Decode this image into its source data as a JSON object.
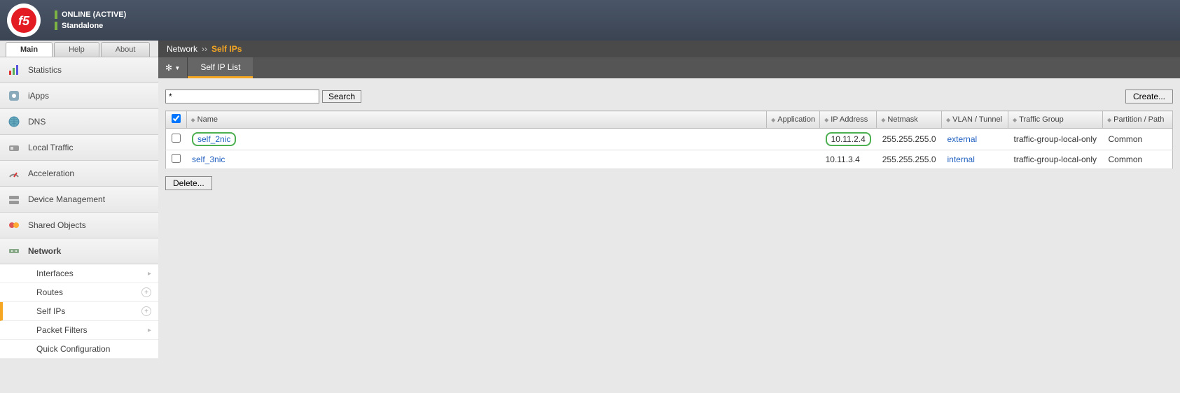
{
  "header": {
    "status_main": "ONLINE (ACTIVE)",
    "status_sub": "Standalone"
  },
  "top_tabs": [
    {
      "label": "Main",
      "active": true
    },
    {
      "label": "Help",
      "active": false
    },
    {
      "label": "About",
      "active": false
    }
  ],
  "sidebar": {
    "items": [
      {
        "label": "Statistics",
        "icon": "stats"
      },
      {
        "label": "iApps",
        "icon": "iapps"
      },
      {
        "label": "DNS",
        "icon": "dns"
      },
      {
        "label": "Local Traffic",
        "icon": "local"
      },
      {
        "label": "Acceleration",
        "icon": "accel"
      },
      {
        "label": "Device Management",
        "icon": "device"
      },
      {
        "label": "Shared Objects",
        "icon": "shared"
      },
      {
        "label": "Network",
        "icon": "network",
        "expanded": true
      }
    ],
    "sub_items": [
      {
        "label": "Interfaces",
        "badge": "arrow"
      },
      {
        "label": "Routes",
        "badge": "plus"
      },
      {
        "label": "Self IPs",
        "badge": "plus",
        "active": true
      },
      {
        "label": "Packet Filters",
        "badge": "arrow"
      },
      {
        "label": "Quick Configuration",
        "badge": ""
      }
    ]
  },
  "breadcrumb": {
    "root": "Network",
    "sep": "››",
    "current": "Self IPs"
  },
  "subtab": {
    "label": "Self IP List"
  },
  "search": {
    "value": "*",
    "button": "Search"
  },
  "buttons": {
    "create": "Create...",
    "delete": "Delete..."
  },
  "table": {
    "headers": {
      "name": "Name",
      "application": "Application",
      "ip": "IP Address",
      "netmask": "Netmask",
      "vlan": "VLAN / Tunnel",
      "tg": "Traffic Group",
      "partition": "Partition / Path"
    },
    "rows": [
      {
        "name": "self_2nic",
        "application": "",
        "ip": "10.11.2.4",
        "netmask": "255.255.255.0",
        "vlan": "external",
        "tg": "traffic-group-local-only",
        "partition": "Common",
        "highlight": true
      },
      {
        "name": "self_3nic",
        "application": "",
        "ip": "10.11.3.4",
        "netmask": "255.255.255.0",
        "vlan": "internal",
        "tg": "traffic-group-local-only",
        "partition": "Common",
        "highlight": false
      }
    ]
  }
}
